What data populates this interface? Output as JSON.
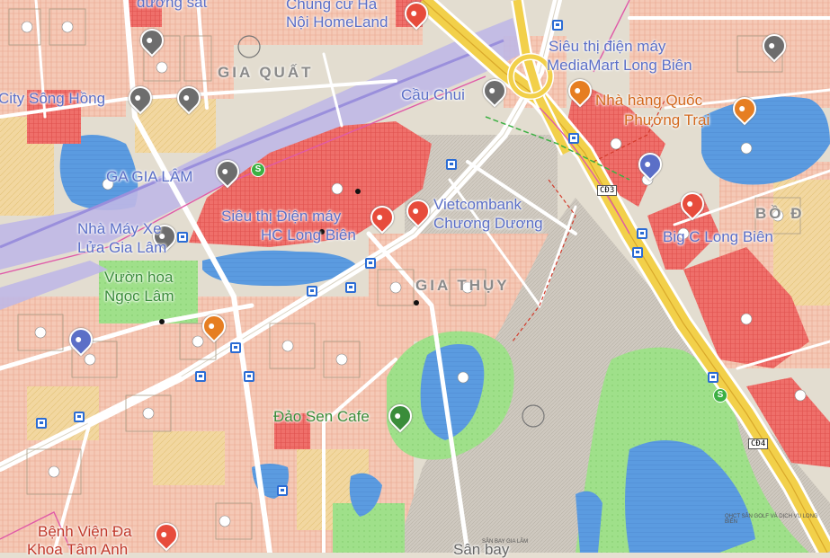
{
  "map": {
    "colors": {
      "residential": "#f5c9b6",
      "mixed_use": "#f2d7a0",
      "commercial": "#ef6f6a",
      "water": "#5b9be0",
      "green": "#9fe08a",
      "transport": "#bfb8e6",
      "rail": "#9a8fdc",
      "road": "#ffffff",
      "highway": "#f2d04a",
      "airport_grey": "#cfc9c0",
      "poi_blue": "#5b6fc7"
    },
    "labels": {
      "top_left_partial": "đường sắt",
      "top_center_partial": "Chung cư Hà",
      "top_center_partial2": "Nội HomeLand",
      "area_gia_quat": "GIA QUẤT",
      "song_hong": "City Sông Hồng",
      "ga_gia_lam": "GA GIA LÂM",
      "cau_chui": "Cầu Chui",
      "sieu_thi_mediamart_1": "Siêu thị điện máy",
      "sieu_thi_mediamart_2": "MediaMart Long Biên",
      "nha_hang_1": "Nhà hàng Quốc",
      "nha_hang_2": "Phương Trại",
      "sieu_thi_hc_1": "Siêu thị Điện máy",
      "sieu_thi_hc_2": "HC Long Biên",
      "vietcombank_1": "Vietcombank",
      "vietcombank_2": "Chương Dương",
      "nha_may_1": "Nhà Máy Xe",
      "nha_may_2": "Lửa Gia Lâm",
      "vuon_hoa_1": "Vườn hoa",
      "vuon_hoa_2": "Ngọc Lâm",
      "area_gia_thuy": "GIA THỤY",
      "area_bo_de": "BỒ Đ",
      "big_c": "Big C Long Biên",
      "dao_sen": "Đảo Sen Cafe",
      "benh_vien_1": "Bệnh Viện Đa",
      "benh_vien_2": "Khoa Tâm Anh",
      "san_bay": "Sân bay",
      "road_code_1": "CĐ3",
      "road_code_2": "CĐ4",
      "golf_note": "QHCT SÂN GOLF VÀ DỊCH VỤ LONG BIÊN",
      "bottom_note": "SÂN BAY GIA LÂM"
    }
  }
}
